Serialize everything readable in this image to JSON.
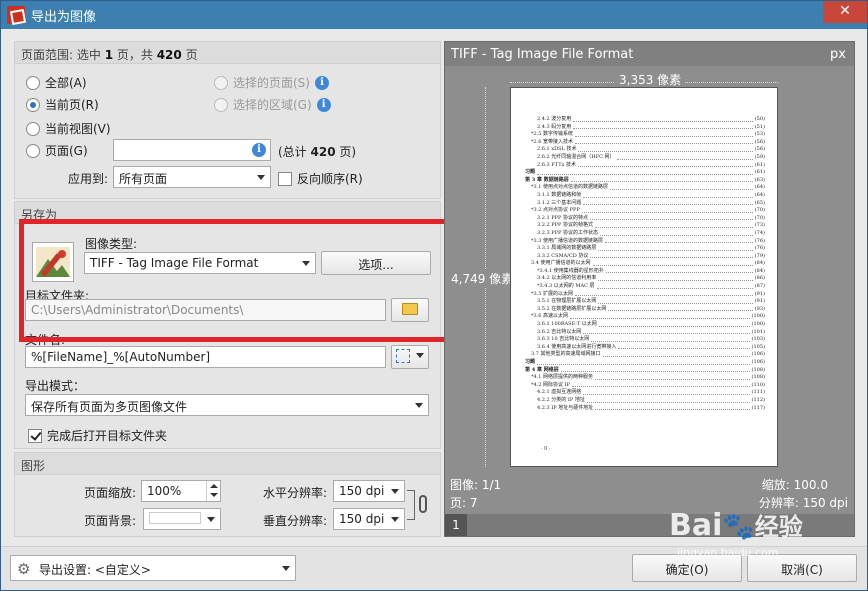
{
  "window": {
    "title": "导出为图像",
    "close": "✕"
  },
  "range": {
    "header_prefix": "页面范围: 选中 ",
    "selected": "1",
    "header_mid": " 页，共 ",
    "total": "420",
    "header_suffix": " 页",
    "all": "全部(A)",
    "current": "当前页(R)",
    "current_view": "当前视图(V)",
    "pages": "页面(G)",
    "selected_pages": "选择的页面(S)",
    "selected_area": "选择的区域(G)",
    "total_prefix": "(总计 ",
    "total_suffix": " 页)",
    "apply_to_label": "应用到:",
    "apply_to_value": "所有页面",
    "reverse": "反向顺序(R)"
  },
  "saveas": {
    "header": "另存为",
    "image_type_label": "图像类型:",
    "image_type_value": "TIFF - Tag Image File Format",
    "options_button": "选项...",
    "target_folder_label": "目标文件夹:",
    "target_folder_value": "C:\\Users\\Administrator\\Documents\\",
    "filename_label": "文件名:",
    "filename_value": "%[FileName]_%[AutoNumber]",
    "export_mode_label": "导出模式：",
    "export_mode_value": "保存所有页面为多页图像文件",
    "open_folder": "完成后打开目标文件夹"
  },
  "graphics": {
    "header": "图形",
    "zoom_label": "页面缩放:",
    "zoom_value": "100%",
    "bg_label": "页面背景:",
    "hres_label": "水平分辨率:",
    "hres_value": "150 dpi",
    "vres_label": "垂直分辨率:",
    "vres_value": "150 dpi"
  },
  "preview": {
    "title": "TIFF - Tag Image File Format",
    "unit": "px",
    "width_label": "3,353 像素",
    "height_label": "4,749 像素",
    "image_label": "图像: 1/1",
    "page_label": "页: 7",
    "zoom_label": "缩放: 100.0",
    "res_label": "分辨率: 150 dpi",
    "thumb_number": "1",
    "toc": [
      {
        "t": "2.4.2  波分复用",
        "p": "(50)"
      },
      {
        "t": "2.4.3  码分复用",
        "p": "(51)"
      },
      {
        "t": "*2.5  数字传输系统",
        "p": "(53)"
      },
      {
        "t": "*2.6  宽带接入技术",
        "p": "(56)"
      },
      {
        "t": "2.6.1  xDSL 技术",
        "p": "(56)"
      },
      {
        "t": "2.6.2  光纤同轴混合网（HFC 网）",
        "p": "(59)"
      },
      {
        "t": "2.6.3  FTTx 技术",
        "p": "(61)"
      },
      {
        "t": "习题",
        "p": "(61)"
      },
      {
        "t": "第 3 章  数据链路层",
        "p": "(63)"
      },
      {
        "t": "*3.1  使用点对点信道的数据链路层",
        "p": "(64)"
      },
      {
        "t": "3.1.1  数据链路和帧",
        "p": "(64)"
      },
      {
        "t": "3.1.2  三个基本问题",
        "p": "(65)"
      },
      {
        "t": "*3.2  点对点协议 PPP",
        "p": "(70)"
      },
      {
        "t": "3.2.1  PPP 协议的特点",
        "p": "(70)"
      },
      {
        "t": "3.2.2  PPP 协议的帧格式",
        "p": "(73)"
      },
      {
        "t": "3.2.3  PPP 协议的工作状态",
        "p": "(74)"
      },
      {
        "t": "*3.3  使用广播信道的数据链路层",
        "p": "(76)"
      },
      {
        "t": "3.3.1  局域网的数据链路层",
        "p": "(76)"
      },
      {
        "t": "3.3.2  CSMA/CD 协议",
        "p": "(79)"
      },
      {
        "t": "3.4  使用广播信道的以太网",
        "p": "(84)"
      },
      {
        "t": "*3.4.1  使用集线器的星形拓扑",
        "p": "(84)"
      },
      {
        "t": "3.4.2  以太网的信道利用率",
        "p": "(86)"
      },
      {
        "t": "*3.4.3  以太网的 MAC 层",
        "p": "(87)"
      },
      {
        "t": "*3.5  扩展的以太网",
        "p": "(91)"
      },
      {
        "t": "3.5.1  在物理层扩展以太网",
        "p": "(91)"
      },
      {
        "t": "3.5.2  在数据链路层扩展以太网",
        "p": "(93)"
      },
      {
        "t": "*3.6  高速以太网",
        "p": "(100)"
      },
      {
        "t": "3.6.1  100BASE-T 以太网",
        "p": "(100)"
      },
      {
        "t": "3.6.2  吉比特以太网",
        "p": "(101)"
      },
      {
        "t": "3.6.3  10 吉比特以太网",
        "p": "(103)"
      },
      {
        "t": "3.6.4  使用高速以太网进行宽带接入",
        "p": "(105)"
      },
      {
        "t": "3.7  其他类型的高速局域网接口",
        "p": "(106)"
      },
      {
        "t": "习题",
        "p": "(106)"
      },
      {
        "t": "第 4 章  网络层",
        "p": "(108)"
      },
      {
        "t": "*4.1  网络层提供的两种服务",
        "p": "(108)"
      },
      {
        "t": "*4.2  网际协议 IP",
        "p": "(110)"
      },
      {
        "t": "4.2.1  虚拟互连网络",
        "p": "(111)"
      },
      {
        "t": "4.2.2  分类的 IP 地址",
        "p": "(112)"
      },
      {
        "t": "4.2.3  IP 地址与硬件地址",
        "p": "(117)"
      }
    ],
    "page_footer": "· II ·"
  },
  "footer": {
    "settings_label": "导出设置: <自定义>",
    "ok": "确定(O)",
    "cancel": "取消(C)"
  },
  "watermark": {
    "brand": "Bai",
    "paw": "🐾",
    "brand2": "经验",
    "url": "jingyan.baidu.com"
  }
}
